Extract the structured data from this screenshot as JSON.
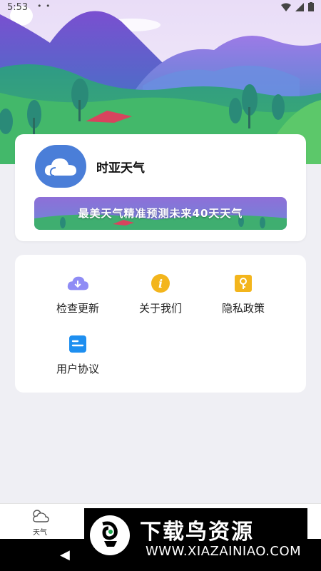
{
  "status_bar": {
    "time": "5:53",
    "dots": "• •"
  },
  "app": {
    "name": "时亚天气",
    "banner_text": "最美天气精准预测未来40天天气"
  },
  "menu": {
    "items": [
      {
        "label": "检查更新",
        "icon": "cloud-download-icon"
      },
      {
        "label": "关于我们",
        "icon": "info-icon"
      },
      {
        "label": "隐私政策",
        "icon": "privacy-key-icon"
      },
      {
        "label": "用户协议",
        "icon": "user-agreement-icon"
      }
    ]
  },
  "tabbar": {
    "weather_label": "天气"
  },
  "watermark": {
    "title": "下载鸟资源",
    "url": "WWW.XIAZAINIAO.COM"
  },
  "colors": {
    "accent_blue": "#4a7ed8",
    "yellow": "#f3b51c",
    "purple_sky": "#b99ee8",
    "green_hill": "#3eb36c"
  }
}
